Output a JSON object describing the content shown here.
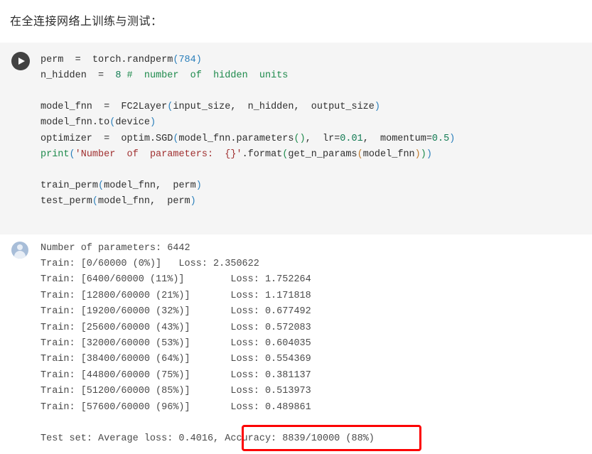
{
  "heading": "在全连接网络上训练与测试：",
  "code_cell": {
    "run_icon": "play-icon",
    "lines": [
      {
        "id": "line-1",
        "tokens": [
          {
            "text": "perm  =  torch.randperm",
            "cls": "t-plain"
          },
          {
            "text": "(",
            "cls": "t-p1"
          },
          {
            "text": "784",
            "cls": "t-num"
          },
          {
            "text": ")",
            "cls": "t-p1"
          }
        ]
      },
      {
        "id": "line-2",
        "tokens": [
          {
            "text": "n_hidden  =  ",
            "cls": "t-plain"
          },
          {
            "text": "8",
            "cls": "t-numg"
          },
          {
            "text": " ",
            "cls": "t-plain"
          },
          {
            "text": "#  number  of  hidden  units",
            "cls": "t-cmt"
          }
        ]
      },
      {
        "id": "line-3",
        "tokens": [
          {
            "text": "",
            "cls": "t-plain"
          }
        ]
      },
      {
        "id": "line-4",
        "tokens": [
          {
            "text": "model_fnn  =  FC2Layer",
            "cls": "t-plain"
          },
          {
            "text": "(",
            "cls": "t-p1"
          },
          {
            "text": "input_size,  n_hidden,  output_size",
            "cls": "t-plain"
          },
          {
            "text": ")",
            "cls": "t-p1"
          }
        ]
      },
      {
        "id": "line-5",
        "tokens": [
          {
            "text": "model_fnn.to",
            "cls": "t-plain"
          },
          {
            "text": "(",
            "cls": "t-p1"
          },
          {
            "text": "device",
            "cls": "t-plain"
          },
          {
            "text": ")",
            "cls": "t-p1"
          }
        ]
      },
      {
        "id": "line-6",
        "tokens": [
          {
            "text": "optimizer  =  optim.SGD",
            "cls": "t-plain"
          },
          {
            "text": "(",
            "cls": "t-p1"
          },
          {
            "text": "model_fnn.parameters",
            "cls": "t-plain"
          },
          {
            "text": "()",
            "cls": "t-p2"
          },
          {
            "text": ",  lr=",
            "cls": "t-plain"
          },
          {
            "text": "0.01",
            "cls": "t-numg"
          },
          {
            "text": ",  momentum=",
            "cls": "t-plain"
          },
          {
            "text": "0.5",
            "cls": "t-numg"
          },
          {
            "text": ")",
            "cls": "t-p1"
          }
        ]
      },
      {
        "id": "line-7",
        "tokens": [
          {
            "text": "print",
            "cls": "t-kw"
          },
          {
            "text": "(",
            "cls": "t-p1"
          },
          {
            "text": "'Number  of  parameters:  {}'",
            "cls": "t-str"
          },
          {
            "text": ".format",
            "cls": "t-plain"
          },
          {
            "text": "(",
            "cls": "t-p2"
          },
          {
            "text": "get_n_params",
            "cls": "t-plain"
          },
          {
            "text": "(",
            "cls": "t-p3"
          },
          {
            "text": "model_fnn",
            "cls": "t-plain"
          },
          {
            "text": ")",
            "cls": "t-p3"
          },
          {
            "text": ")",
            "cls": "t-p2"
          },
          {
            "text": ")",
            "cls": "t-p1"
          }
        ]
      },
      {
        "id": "line-8",
        "tokens": [
          {
            "text": "",
            "cls": "t-plain"
          }
        ]
      },
      {
        "id": "line-9",
        "tokens": [
          {
            "text": "train_perm",
            "cls": "t-plain"
          },
          {
            "text": "(",
            "cls": "t-p1"
          },
          {
            "text": "model_fnn,  perm",
            "cls": "t-plain"
          },
          {
            "text": ")",
            "cls": "t-p1"
          }
        ]
      },
      {
        "id": "line-10",
        "tokens": [
          {
            "text": "test_perm",
            "cls": "t-plain"
          },
          {
            "text": "(",
            "cls": "t-p1"
          },
          {
            "text": "model_fnn,  perm",
            "cls": "t-plain"
          },
          {
            "text": ")",
            "cls": "t-p1"
          }
        ]
      }
    ]
  },
  "output_cell": {
    "avatar_icon": "user-avatar-icon",
    "lines": [
      "Number of parameters: 6442",
      "Train: [0/60000 (0%)]   Loss: 2.350622",
      "Train: [6400/60000 (11%)]        Loss: 1.752264",
      "Train: [12800/60000 (21%)]       Loss: 1.171818",
      "Train: [19200/60000 (32%)]       Loss: 0.677492",
      "Train: [25600/60000 (43%)]       Loss: 0.572083",
      "Train: [32000/60000 (53%)]       Loss: 0.604035",
      "Train: [38400/60000 (64%)]       Loss: 0.554369",
      "Train: [44800/60000 (75%)]       Loss: 0.381137",
      "Train: [51200/60000 (85%)]       Loss: 0.513973",
      "Train: [57600/60000 (96%)]       Loss: 0.489861",
      ""
    ],
    "test_line": "Test set: Average loss: 0.4016, Accuracy: 8839/10000 (88%)",
    "annotation": {
      "name": "accuracy-highlight-box",
      "color": "#fc0000",
      "highlighted_text": "Accuracy: 8839/10000 (88%)"
    }
  },
  "training_log": {
    "num_parameters": 6442,
    "total_samples": 60000,
    "steps": [
      {
        "samples": 0,
        "percent": 0,
        "loss": 2.350622
      },
      {
        "samples": 6400,
        "percent": 11,
        "loss": 1.752264
      },
      {
        "samples": 12800,
        "percent": 21,
        "loss": 1.171818
      },
      {
        "samples": 19200,
        "percent": 32,
        "loss": 0.677492
      },
      {
        "samples": 25600,
        "percent": 43,
        "loss": 0.572083
      },
      {
        "samples": 32000,
        "percent": 53,
        "loss": 0.604035
      },
      {
        "samples": 38400,
        "percent": 64,
        "loss": 0.554369
      },
      {
        "samples": 44800,
        "percent": 75,
        "loss": 0.381137
      },
      {
        "samples": 51200,
        "percent": 85,
        "loss": 0.513973
      },
      {
        "samples": 57600,
        "percent": 96,
        "loss": 0.489861
      }
    ],
    "test": {
      "average_loss": 0.4016,
      "correct": 8839,
      "total": 10000,
      "accuracy_percent": 88
    }
  }
}
